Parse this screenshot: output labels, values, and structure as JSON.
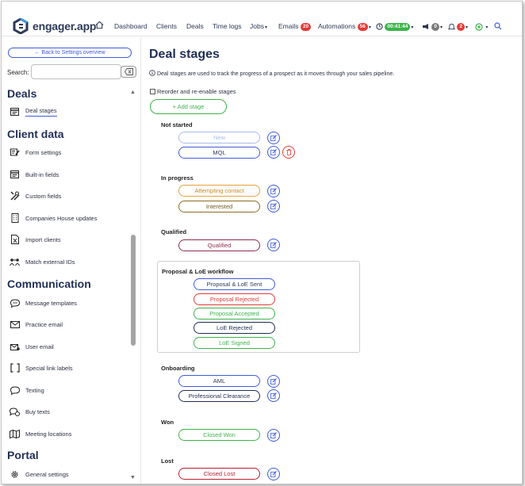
{
  "app": {
    "logo_text": "engager.app"
  },
  "nav": {
    "dashboard": "Dashboard",
    "clients": "Clients",
    "deals": "Deals",
    "time_logs": "Time logs",
    "jobs": "Jobs",
    "emails": "Emails",
    "emails_badge": "20",
    "automations": "Automations",
    "automations_badge": "56",
    "timer": "00:41:44",
    "announcements_badge": "0",
    "notifications_badge": "2"
  },
  "sidebar": {
    "back_label": "← Back to Settings overview",
    "search_label": "Search:",
    "search_value": "",
    "sections": {
      "deals": "Deals",
      "client_data": "Client data",
      "communication": "Communication",
      "portal": "Portal"
    },
    "items": {
      "deal_stages": "Deal stages",
      "form_settings": "Form settings",
      "built_in_fields": "Built-in fields",
      "custom_fields": "Custom fields",
      "companies_house": "Companies House updates",
      "import_clients": "Import clients",
      "match_external": "Match external IDs",
      "message_templates": "Message templates",
      "practice_email": "Practice email",
      "user_email": "User email",
      "special_link": "Special link labels",
      "texting": "Texting",
      "buy_texts": "Buy texts",
      "meeting_locations": "Meeting locations",
      "general_settings": "General settings"
    }
  },
  "main": {
    "title": "Deal stages",
    "description": "Deal stages are used to track the progress of a prospect as it moves through your sales pipeline.",
    "reorder_label": "Reorder and re-enable stages",
    "add_stage_label": "+ Add stage",
    "groups": {
      "not_started": "Not started",
      "in_progress": "In progress",
      "qualified": "Qualified",
      "proposal_loe": "Proposal & LoE workflow",
      "onboarding": "Onboarding",
      "won": "Won",
      "lost": "Lost"
    },
    "stages": {
      "new": "New",
      "mql": "MQL",
      "attempting_contact": "Attempting contact",
      "interested": "Interested",
      "qualified": "Qualified",
      "proposal_sent": "Proposal & LoE Sent",
      "proposal_rejected": "Proposal Rejected",
      "proposal_accepted": "Proposal Accepted",
      "loe_rejected": "LoE Rejected",
      "loe_signed": "LoE Signed",
      "aml": "AML",
      "professional_clearance": "Professional Clearance",
      "closed_won": "Closed Won",
      "closed_lost": "Closed Lost"
    }
  },
  "colors": {
    "brand_navy": "#1f2f55",
    "accent_blue": "#3f5bd9",
    "green": "#3db34a",
    "red": "#e53935",
    "orange": "#e6a23c",
    "brown": "#8a6d1d",
    "maroon": "#8c2f4e",
    "light_blue": "#9fb4e8",
    "navy_dark": "#2c3a57"
  }
}
